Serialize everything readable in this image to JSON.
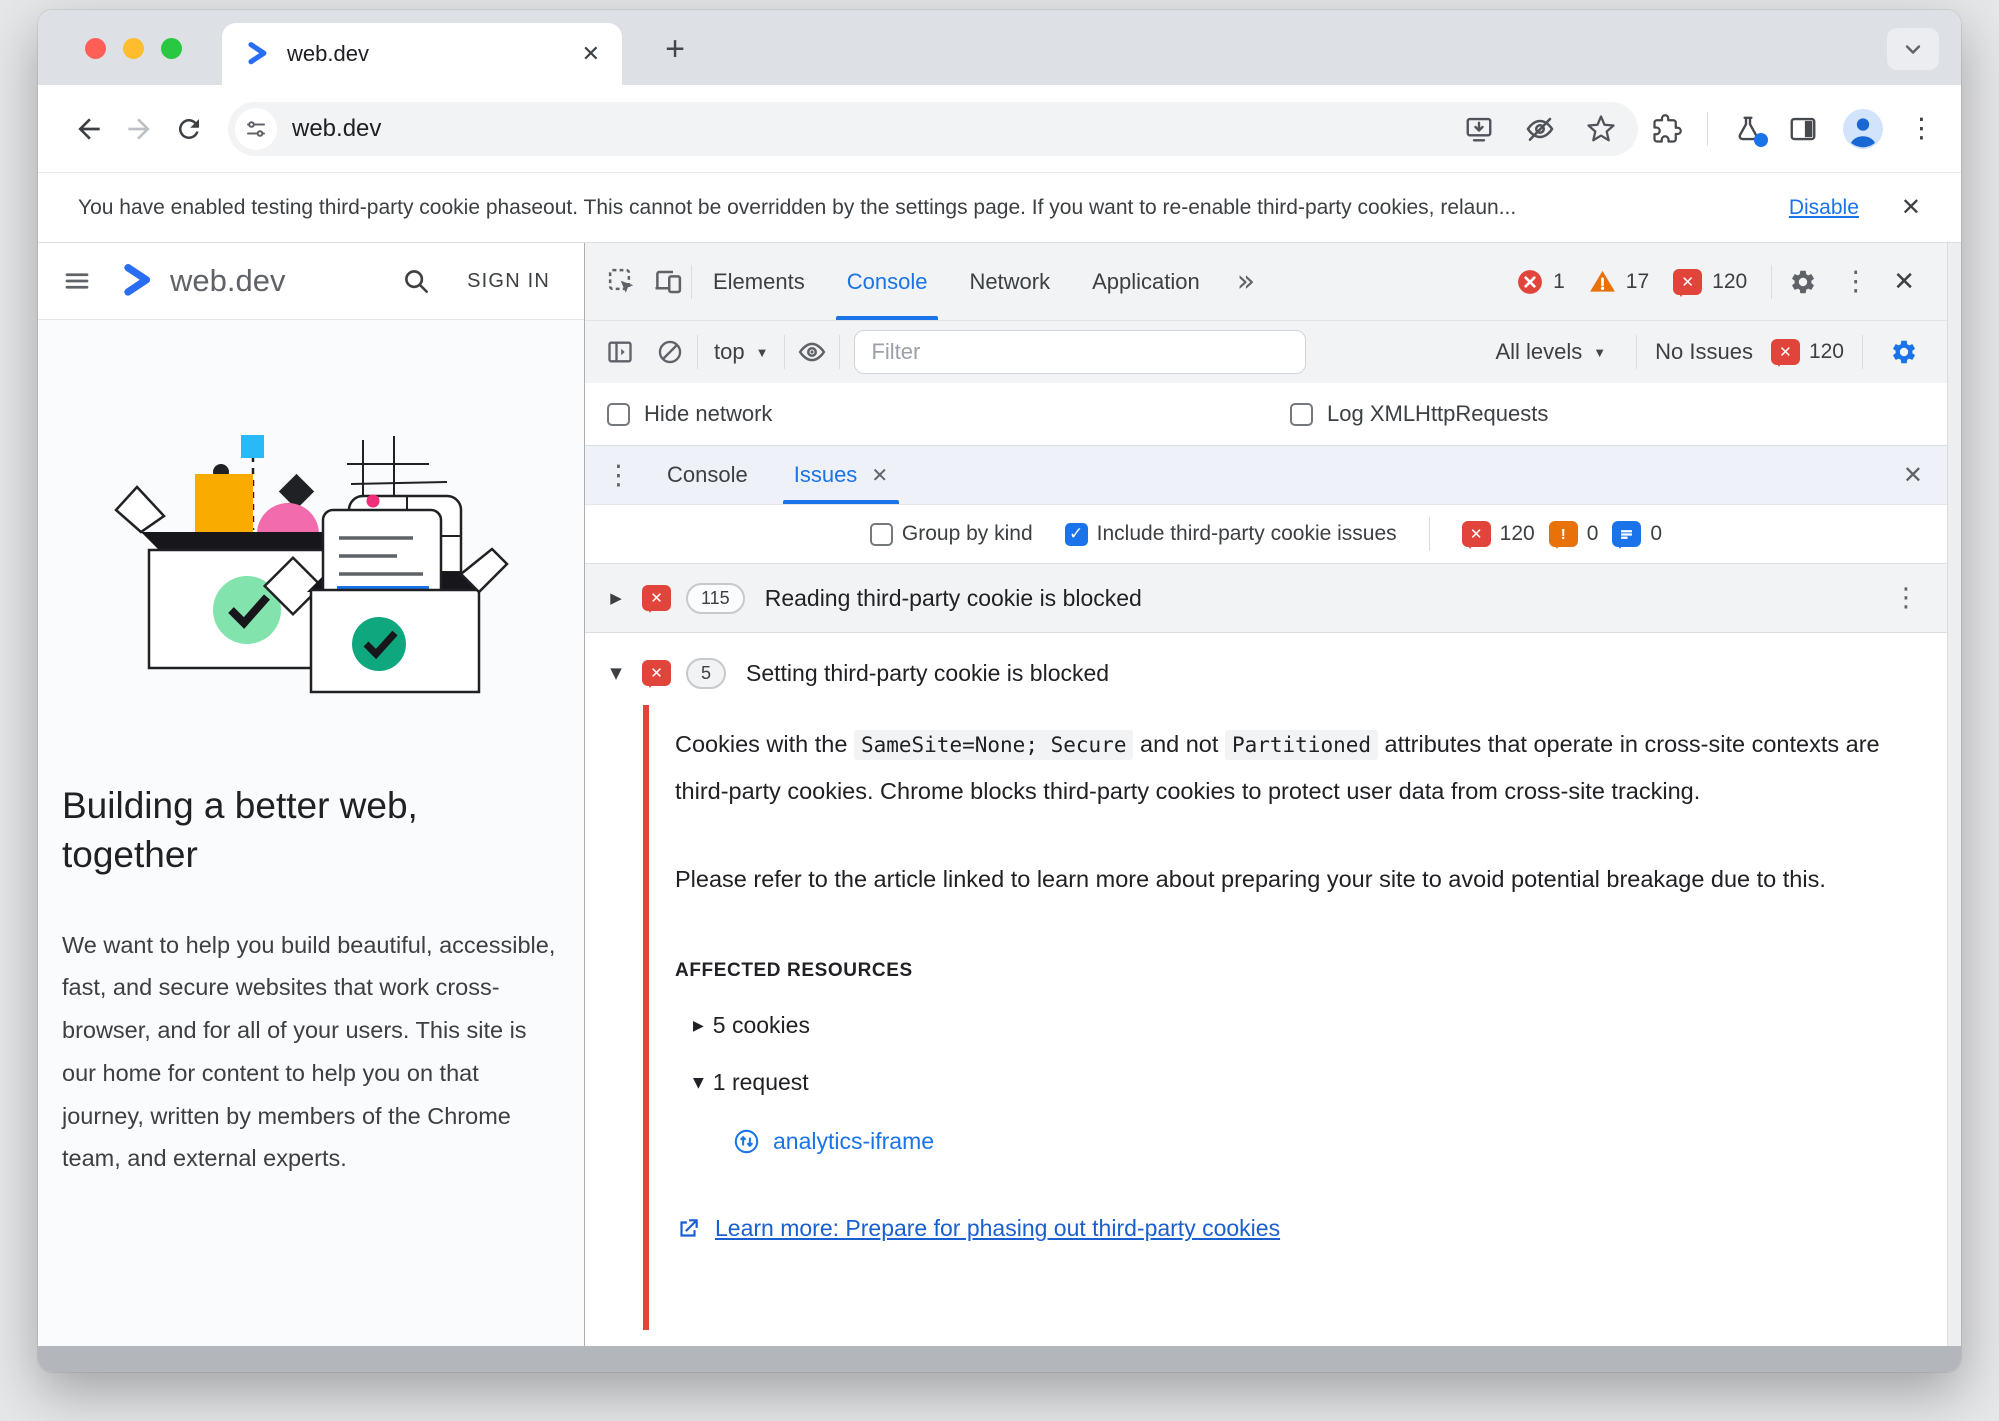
{
  "window": {
    "tab_title": "web.dev",
    "url": "web.dev"
  },
  "icons": {
    "close": "✕",
    "plus": "+",
    "kebab": "⋮",
    "more_tabs": "»",
    "dropdown": "▼",
    "collapsed": "▶",
    "expanded": "▼",
    "check": "✓"
  },
  "infobar": {
    "message": "You have enabled testing third-party cookie phaseout. This cannot be overridden by the settings page. If you want to re-enable third-party cookies, relaun...",
    "action": "Disable"
  },
  "site": {
    "brand": "web.dev",
    "sign_in": "SIGN IN",
    "heading": "Building a better web, together",
    "intro": "We want to help you build beautiful, accessible, fast, and secure websites that work cross-browser, and for all of your users. This site is our home for content to help you on that journey, written by members of the Chrome team, and external experts."
  },
  "devtools": {
    "panel_tabs": {
      "elements": "Elements",
      "console": "Console",
      "network": "Network",
      "application": "Application"
    },
    "badges": {
      "errors": "1",
      "warnings": "17",
      "issues": "120"
    },
    "console_toolbar": {
      "context": "top",
      "filter_placeholder": "Filter",
      "levels": "All levels",
      "issues_label": "No Issues",
      "issues_count": "120"
    },
    "console_settings": {
      "hide_network": "Hide network",
      "log_xhr": "Log XMLHttpRequests"
    },
    "drawer_tabs": {
      "console": "Console",
      "issues": "Issues"
    },
    "issues_bar": {
      "group_by_kind": "Group by kind",
      "include_third_party": "Include third-party cookie issues",
      "error_count": "120",
      "warning_count": "0",
      "info_count": "0"
    },
    "issue_collapsed": {
      "count": "115",
      "title": "Reading third-party cookie is blocked"
    },
    "issue_expanded": {
      "count": "5",
      "title": "Setting third-party cookie is blocked",
      "p1_a": "Cookies with the ",
      "p1_code1": "SameSite=None; Secure",
      "p1_b": " and not ",
      "p1_code2": "Partitioned",
      "p1_c": " attributes that operate in cross-site contexts are third-party cookies. Chrome blocks third-party cookies to protect user data from cross-site tracking.",
      "p2": "Please refer to the article linked to learn more about preparing your site to avoid potential breakage due to this.",
      "affected_label": "AFFECTED RESOURCES",
      "cookies": "5 cookies",
      "request": "1 request",
      "request_name": "analytics-iframe",
      "learn_more": "Learn more: Prepare for phasing out third-party cookies"
    }
  },
  "colors": {
    "accent_blue": "#1a73e8",
    "error_red": "#e0443a",
    "warning_orange": "#e8710a",
    "link_blue": "#1a5fd0",
    "toolbar_gray": "#f1f3f4"
  }
}
